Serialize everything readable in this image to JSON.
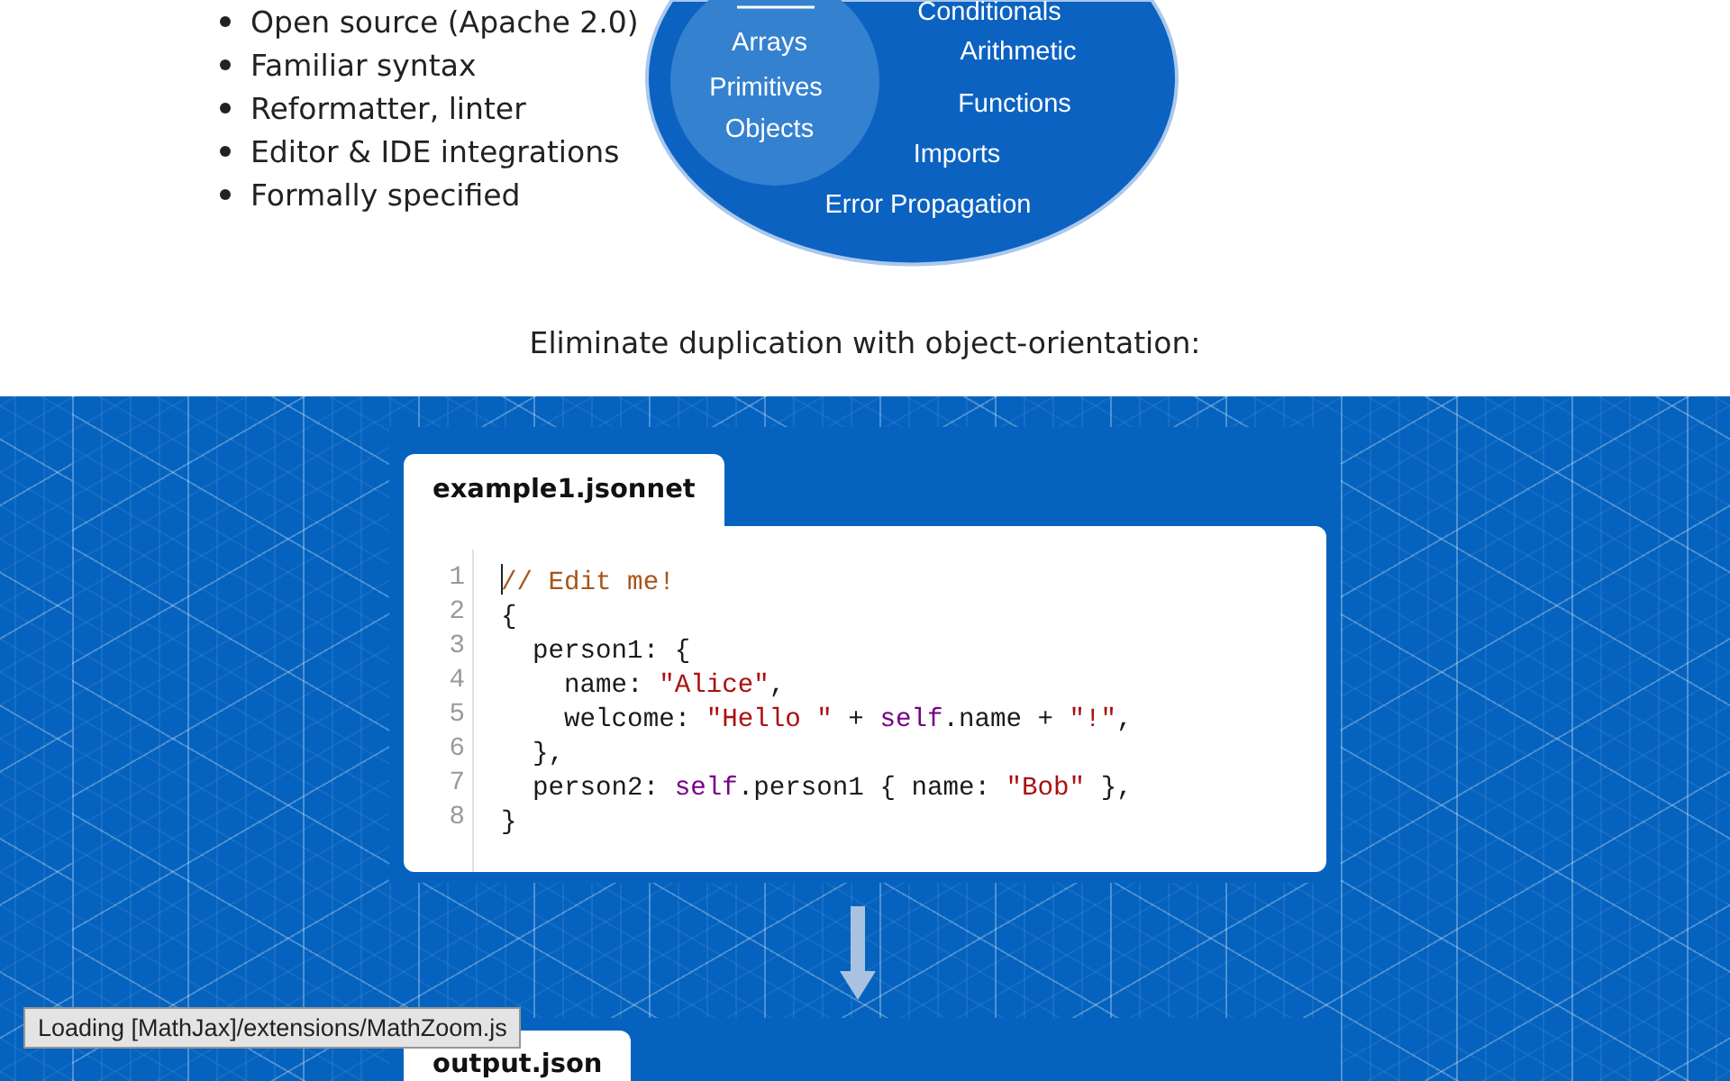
{
  "features_list": [
    "Open source (Apache 2.0)",
    "Familiar syntax",
    "Reformatter, linter",
    "Editor & IDE integrations",
    "Formally specified"
  ],
  "diagram": {
    "inner_items": [
      "Arrays",
      "Primitives",
      "Objects"
    ],
    "outer_items": [
      "Conditionals",
      "Arithmetic",
      "Functions",
      "Imports",
      "Error Propagation"
    ]
  },
  "heading": "Eliminate duplication with object-orientation:",
  "editor": {
    "tab": "example1.jsonnet",
    "lines": [
      {
        "number": "1",
        "cursor": true,
        "tokens": [
          {
            "text": "// Edit me!",
            "kind": "comment"
          }
        ]
      },
      {
        "number": "2",
        "cursor": false,
        "tokens": [
          {
            "text": "{",
            "kind": "plain"
          }
        ]
      },
      {
        "number": "3",
        "cursor": false,
        "tokens": [
          {
            "text": "  person1: {",
            "kind": "plain"
          }
        ]
      },
      {
        "number": "4",
        "cursor": false,
        "tokens": [
          {
            "text": "    name: ",
            "kind": "plain"
          },
          {
            "text": "\"Alice\"",
            "kind": "string"
          },
          {
            "text": ",",
            "kind": "plain"
          }
        ]
      },
      {
        "number": "5",
        "cursor": false,
        "tokens": [
          {
            "text": "    welcome: ",
            "kind": "plain"
          },
          {
            "text": "\"Hello \"",
            "kind": "string"
          },
          {
            "text": " + ",
            "kind": "plain"
          },
          {
            "text": "self",
            "kind": "keyword"
          },
          {
            "text": ".name + ",
            "kind": "plain"
          },
          {
            "text": "\"!\"",
            "kind": "string"
          },
          {
            "text": ",",
            "kind": "plain"
          }
        ]
      },
      {
        "number": "6",
        "cursor": false,
        "tokens": [
          {
            "text": "  },",
            "kind": "plain"
          }
        ]
      },
      {
        "number": "7",
        "cursor": false,
        "tokens": [
          {
            "text": "  person2: ",
            "kind": "plain"
          },
          {
            "text": "self",
            "kind": "keyword"
          },
          {
            "text": ".person1 { name: ",
            "kind": "plain"
          },
          {
            "text": "\"Bob\"",
            "kind": "string"
          },
          {
            "text": " },",
            "kind": "plain"
          }
        ]
      },
      {
        "number": "8",
        "cursor": false,
        "tokens": [
          {
            "text": "}",
            "kind": "plain"
          }
        ]
      }
    ]
  },
  "output": {
    "tab": "output.json"
  },
  "status_message": "Loading [MathJax]/extensions/MathZoom.js"
}
